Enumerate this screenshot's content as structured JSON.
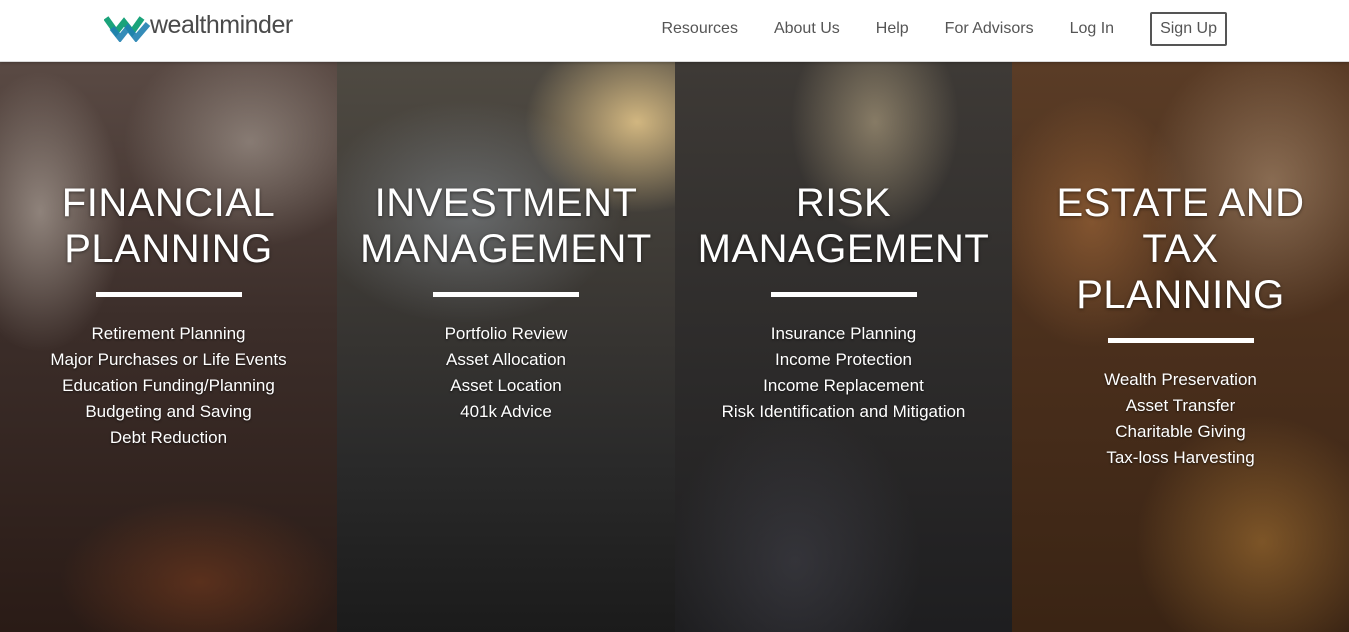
{
  "brand": {
    "name": "wealthminder",
    "colors": {
      "accent_green": "#1aa37a",
      "accent_blue": "#1f7fb0",
      "text": "#4a4a4a"
    }
  },
  "nav": {
    "items": [
      "Resources",
      "About Us",
      "Help",
      "For Advisors",
      "Log In"
    ],
    "signup_label": "Sign Up"
  },
  "panels": [
    {
      "title_lines": [
        "FINANCIAL",
        "PLANNING"
      ],
      "items": [
        "Retirement Planning",
        "Major Purchases or Life Events",
        "Education Funding/Planning",
        "Budgeting and Saving",
        "Debt Reduction"
      ]
    },
    {
      "title_lines": [
        "INVESTMENT",
        "MANAGEMENT"
      ],
      "items": [
        "Portfolio Review",
        "Asset Allocation",
        "Asset Location",
        "401k Advice"
      ]
    },
    {
      "title_lines": [
        "RISK",
        "MANAGEMENT"
      ],
      "items": [
        "Insurance Planning",
        "Income Protection",
        "Income Replacement",
        "Risk Identification and Mitigation"
      ]
    },
    {
      "title_lines": [
        "ESTATE AND",
        "TAX",
        "PLANNING"
      ],
      "items": [
        "Wealth Preservation",
        "Asset Transfer",
        "Charitable Giving",
        "Tax-loss Harvesting"
      ]
    }
  ]
}
